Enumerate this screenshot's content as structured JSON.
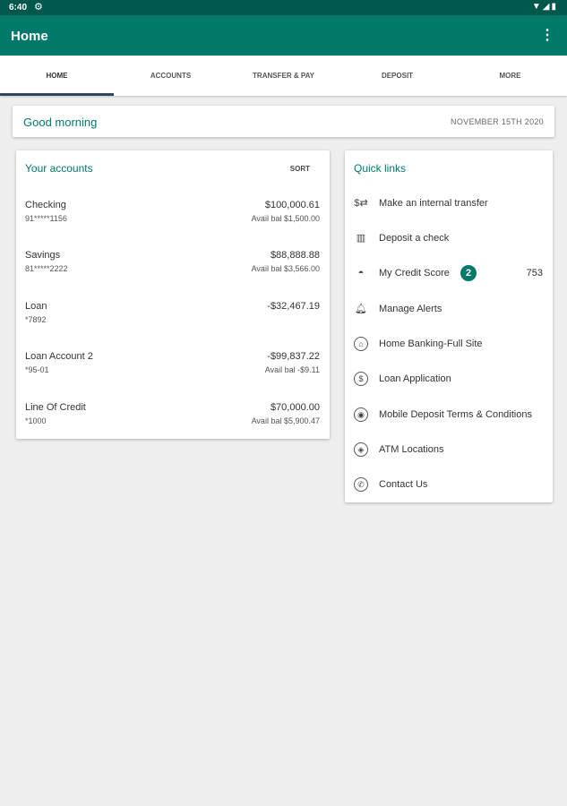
{
  "status_bar": {
    "time": "6:40",
    "system_icons": "▼◢▮"
  },
  "app_bar": {
    "title": "Home",
    "menu_icon": "⋮"
  },
  "tabs": [
    {
      "label": "HOME",
      "active": true
    },
    {
      "label": "ACCOUNTS",
      "active": false
    },
    {
      "label": "TRANSFER & PAY",
      "active": false
    },
    {
      "label": "DEPOSIT",
      "active": false
    },
    {
      "label": "MORE",
      "active": false
    }
  ],
  "greeting": {
    "text": "Good morning",
    "date": "NOVEMBER 15TH 2020"
  },
  "accounts": {
    "title": "Your accounts",
    "sort_label": "SORT",
    "items": [
      {
        "name": "Checking",
        "number": "91*****1156",
        "balance": "$100,000.61",
        "avail": "Avail bal $1,500.00"
      },
      {
        "name": "Savings",
        "number": "81*****2222",
        "balance": "$88,888.88",
        "avail": "Avail bal $3,566.00"
      },
      {
        "name": "Loan",
        "number": "*7892",
        "balance": "-$32,467.19",
        "avail": ""
      },
      {
        "name": "Loan Account 2",
        "number": "*95-01",
        "balance": "-$99,837.22",
        "avail": "Avail bal -$9.11"
      },
      {
        "name": "Line Of Credit",
        "number": "*1000",
        "balance": "$70,000.00",
        "avail": "Avail bal $5,900.47"
      }
    ]
  },
  "quick_links": {
    "title": "Quick links",
    "items": [
      {
        "label": "Make an internal transfer",
        "icon": "transfer-icon"
      },
      {
        "label": "Deposit a check",
        "icon": "check-deposit-icon"
      },
      {
        "label": "My Credit Score",
        "icon": "gauge-icon",
        "badge": "2",
        "value": "753"
      },
      {
        "label": "Manage Alerts",
        "icon": "bell-icon"
      },
      {
        "label": "Home Banking-Full Site",
        "icon": "bank-icon"
      },
      {
        "label": "Loan Application",
        "icon": "dollar-icon"
      },
      {
        "label": "Mobile Deposit Terms & Conditions",
        "icon": "eye-icon"
      },
      {
        "label": "ATM Locations",
        "icon": "location-icon"
      },
      {
        "label": "Contact Us",
        "icon": "phone-icon"
      }
    ]
  },
  "colors": {
    "primary": "#00796b",
    "status_bar": "#00574b",
    "background": "#eeeeee"
  }
}
